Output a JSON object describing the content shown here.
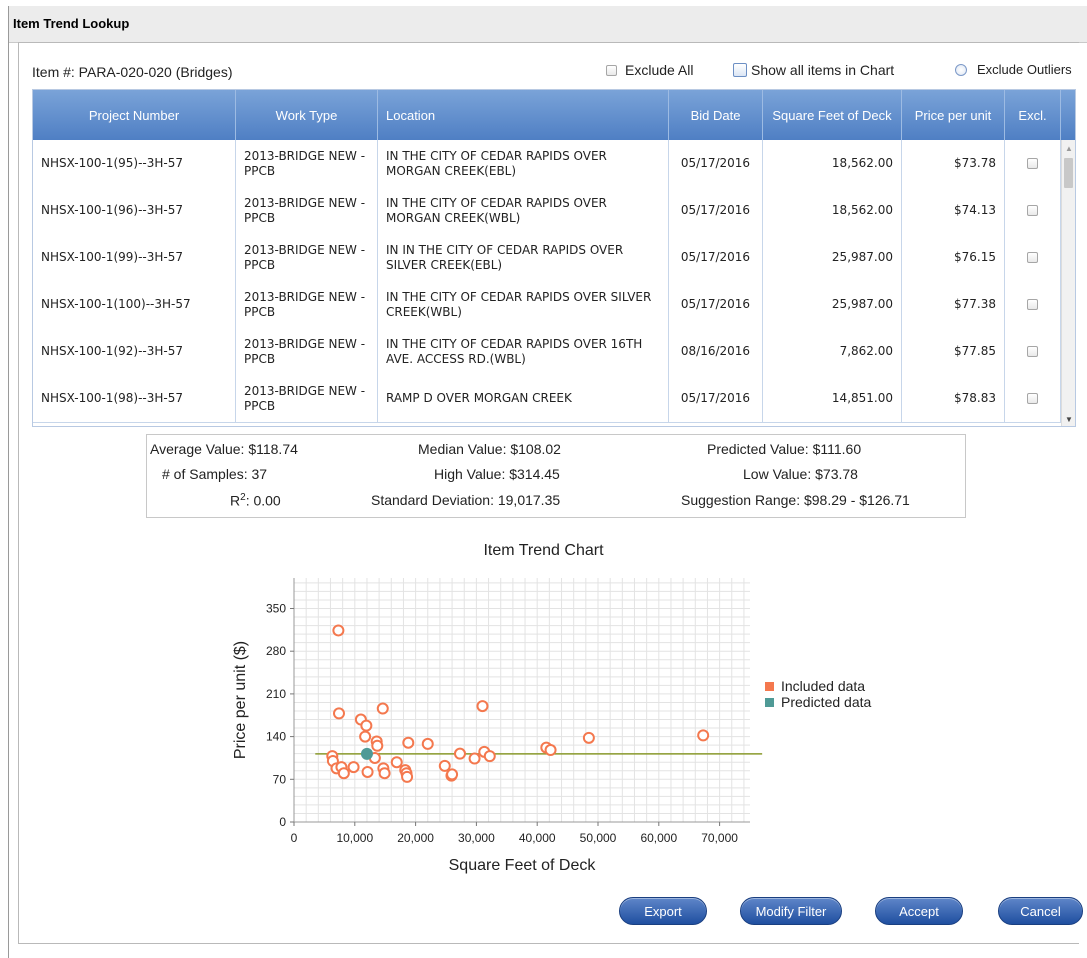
{
  "dialog": {
    "title": "Item Trend Lookup"
  },
  "item": {
    "label": "Item #: PARA-020-020 (Bridges)"
  },
  "options": {
    "exclude_all": "Exclude All",
    "show_all": "Show all items in Chart",
    "exclude_outliers": "Exclude Outliers"
  },
  "table": {
    "headers": [
      "Project Number",
      "Work Type",
      "Location",
      "Bid Date",
      "Square Feet of Deck",
      "Price per unit",
      "Excl."
    ],
    "rows": [
      {
        "project": "NHSX-100-1(95)--3H-57",
        "work_type": "2013-BRIDGE NEW - PPCB",
        "location": "IN THE CITY OF CEDAR RAPIDS OVER MORGAN CREEK(EBL)",
        "bid_date": "05/17/2016",
        "sqft": "18,562.00",
        "price": "$73.78"
      },
      {
        "project": "NHSX-100-1(96)--3H-57",
        "work_type": "2013-BRIDGE NEW - PPCB",
        "location": "IN THE CITY OF CEDAR RAPIDS OVER MORGAN CREEK(WBL)",
        "bid_date": "05/17/2016",
        "sqft": "18,562.00",
        "price": "$74.13"
      },
      {
        "project": "NHSX-100-1(99)--3H-57",
        "work_type": "2013-BRIDGE NEW - PPCB",
        "location": "IN IN THE CITY OF CEDAR RAPIDS OVER SILVER CREEK(EBL)",
        "bid_date": "05/17/2016",
        "sqft": "25,987.00",
        "price": "$76.15"
      },
      {
        "project": "NHSX-100-1(100)--3H-57",
        "work_type": "2013-BRIDGE NEW - PPCB",
        "location": "IN THE CITY OF CEDAR RAPIDS OVER SILVER CREEK(WBL)",
        "bid_date": "05/17/2016",
        "sqft": "25,987.00",
        "price": "$77.38"
      },
      {
        "project": "NHSX-100-1(92)--3H-57",
        "work_type": "2013-BRIDGE NEW - PPCB",
        "location": "IN THE CITY OF CEDAR RAPIDS OVER 16TH AVE. ACCESS RD.(WBL)",
        "bid_date": "08/16/2016",
        "sqft": "7,862.00",
        "price": "$77.85"
      },
      {
        "project": "NHSX-100-1(98)--3H-57",
        "work_type": "2013-BRIDGE NEW - PPCB",
        "location": "RAMP D OVER MORGAN CREEK",
        "bid_date": "05/17/2016",
        "sqft": "14,851.00",
        "price": "$78.83"
      }
    ]
  },
  "stats": {
    "average": "Average Value: $118.74",
    "median": "Median Value: $108.02",
    "predicted": "Predicted Value: $111.60",
    "samples": "# of Samples: 37",
    "high": "High Value: $314.45",
    "low": "Low Value: $73.78",
    "r2_label": "R",
    "r2_sup": "2",
    "r2_value": ": 0.00",
    "std_dev": "Standard Deviation: 19,017.35",
    "suggestion": "Suggestion Range: $98.29 - $126.71"
  },
  "chart_data": {
    "type": "scatter",
    "title": "Item Trend Chart",
    "xlabel": "Square Feet of Deck",
    "ylabel": "Price per unit ($)",
    "xlim": [
      0,
      75000
    ],
    "ylim": [
      0,
      400
    ],
    "xticks": [
      "0",
      "10,000",
      "20,000",
      "30,000",
      "40,000",
      "50,000",
      "60,000",
      "70,000"
    ],
    "xtick_values": [
      0,
      10000,
      20000,
      30000,
      40000,
      50000,
      60000,
      70000
    ],
    "yticks": [
      "0",
      "70",
      "140",
      "210",
      "280",
      "350"
    ],
    "ytick_values": [
      0,
      70,
      140,
      210,
      280,
      350
    ],
    "grid": true,
    "legend_position": "right",
    "series": [
      {
        "name": "Included data",
        "color": "#f4784e",
        "points": [
          [
            7300,
            314
          ],
          [
            7400,
            178
          ],
          [
            6300,
            108
          ],
          [
            6400,
            100
          ],
          [
            7000,
            88
          ],
          [
            7800,
            90
          ],
          [
            8200,
            80
          ],
          [
            9800,
            90
          ],
          [
            11000,
            168
          ],
          [
            11700,
            140
          ],
          [
            11900,
            158
          ],
          [
            12100,
            82
          ],
          [
            13300,
            105
          ],
          [
            13600,
            132
          ],
          [
            13700,
            125
          ],
          [
            14600,
            186
          ],
          [
            14700,
            88
          ],
          [
            14900,
            80
          ],
          [
            16900,
            98
          ],
          [
            18300,
            85
          ],
          [
            18500,
            80
          ],
          [
            18600,
            74
          ],
          [
            18800,
            130
          ],
          [
            22000,
            128
          ],
          [
            24800,
            92
          ],
          [
            25900,
            76
          ],
          [
            26000,
            78
          ],
          [
            27300,
            112
          ],
          [
            29700,
            104
          ],
          [
            31000,
            190
          ],
          [
            31300,
            115
          ],
          [
            32200,
            108
          ],
          [
            41500,
            122
          ],
          [
            42200,
            118
          ],
          [
            48500,
            138
          ],
          [
            67300,
            142
          ]
        ]
      },
      {
        "name": "Predicted data",
        "color": "#4f9a96",
        "points": [
          [
            12000,
            111.6
          ]
        ]
      }
    ],
    "trend_line": {
      "color": "#8a9a2c",
      "y": 111.6,
      "x_from": 3500,
      "x_to": 77000
    }
  },
  "buttons": {
    "export": "Export",
    "modify": "Modify Filter",
    "accept": "Accept",
    "cancel": "Cancel"
  }
}
